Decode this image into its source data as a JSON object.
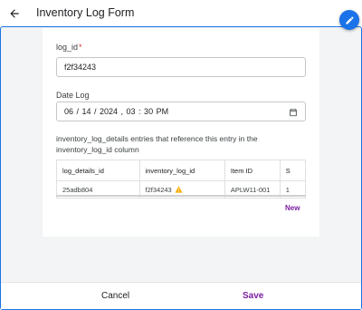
{
  "header": {
    "title": "Inventory Log Form"
  },
  "form": {
    "log_id": {
      "label": "log_id",
      "required_mark": "*",
      "value": "f2f34243"
    },
    "date_log": {
      "label": "Date Log",
      "value": "06 / 14 / 2024 , 03 : 30  PM"
    },
    "related": {
      "description": "inventory_log_details entries that reference this entry in the inventory_log_id column",
      "columns": [
        "log_details_id",
        "inventory_log_id",
        "Item ID",
        "S"
      ],
      "rows": [
        [
          "25adb804",
          "f2f34243",
          "APLW11-001",
          "1"
        ]
      ],
      "new_label": "New"
    }
  },
  "footer": {
    "cancel_label": "Cancel",
    "save_label": "Save"
  },
  "colors": {
    "accent": "#1a73e8",
    "action": "#7b1fa2",
    "warning": "#f9ab00",
    "required": "#d93025"
  },
  "icons": [
    "arrow-back-icon",
    "pencil-icon",
    "calendar-icon",
    "warning-icon"
  ]
}
